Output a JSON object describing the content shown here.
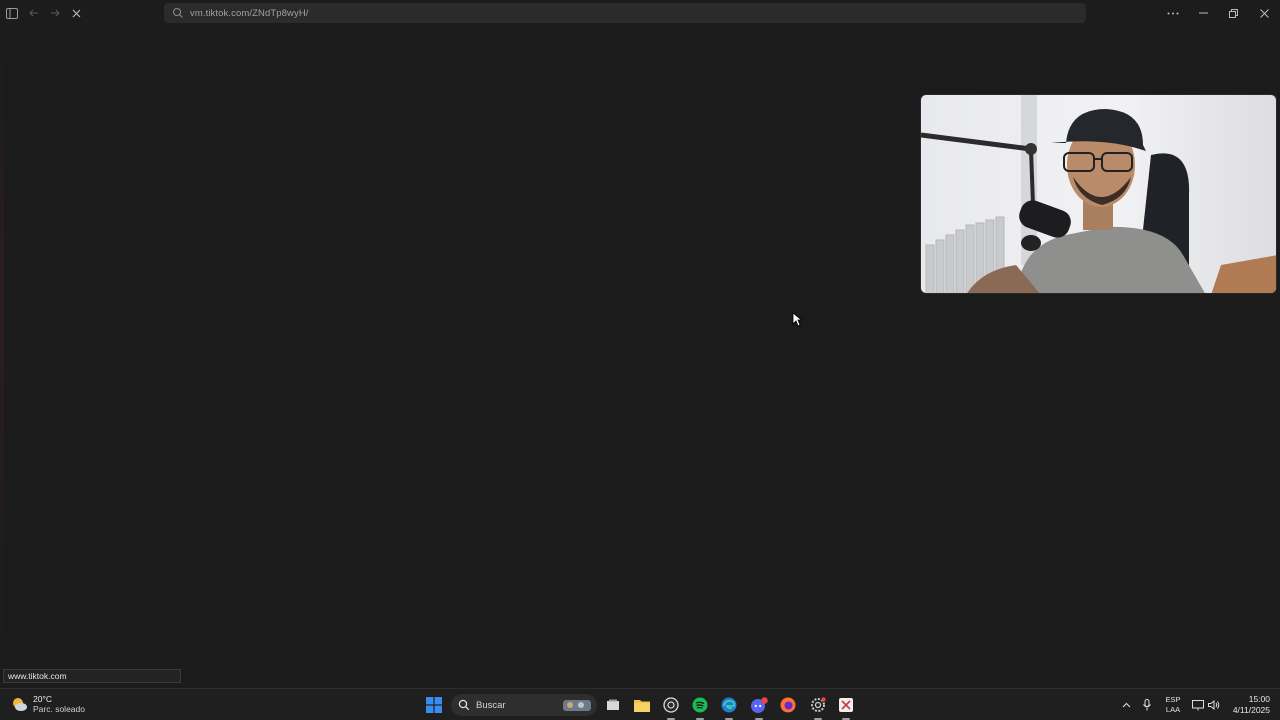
{
  "browser": {
    "url": "vm.tiktok.com/ZNdTp8wyH/",
    "status_link": "www.tiktok.com"
  },
  "taskbar": {
    "weather": {
      "temp": "20°C",
      "condition": "Parc. soleado"
    },
    "search_label": "Buscar",
    "language": {
      "line1": "ESP",
      "line2": "LAA"
    },
    "clock": {
      "time": "15:00",
      "date": "4/11/2025"
    }
  },
  "colors": {
    "page_bg": "#1b1b1b",
    "taskbar_bg": "#1f1f1f",
    "windows_blue": "#3a8df0",
    "spotify_green": "#1db954"
  }
}
